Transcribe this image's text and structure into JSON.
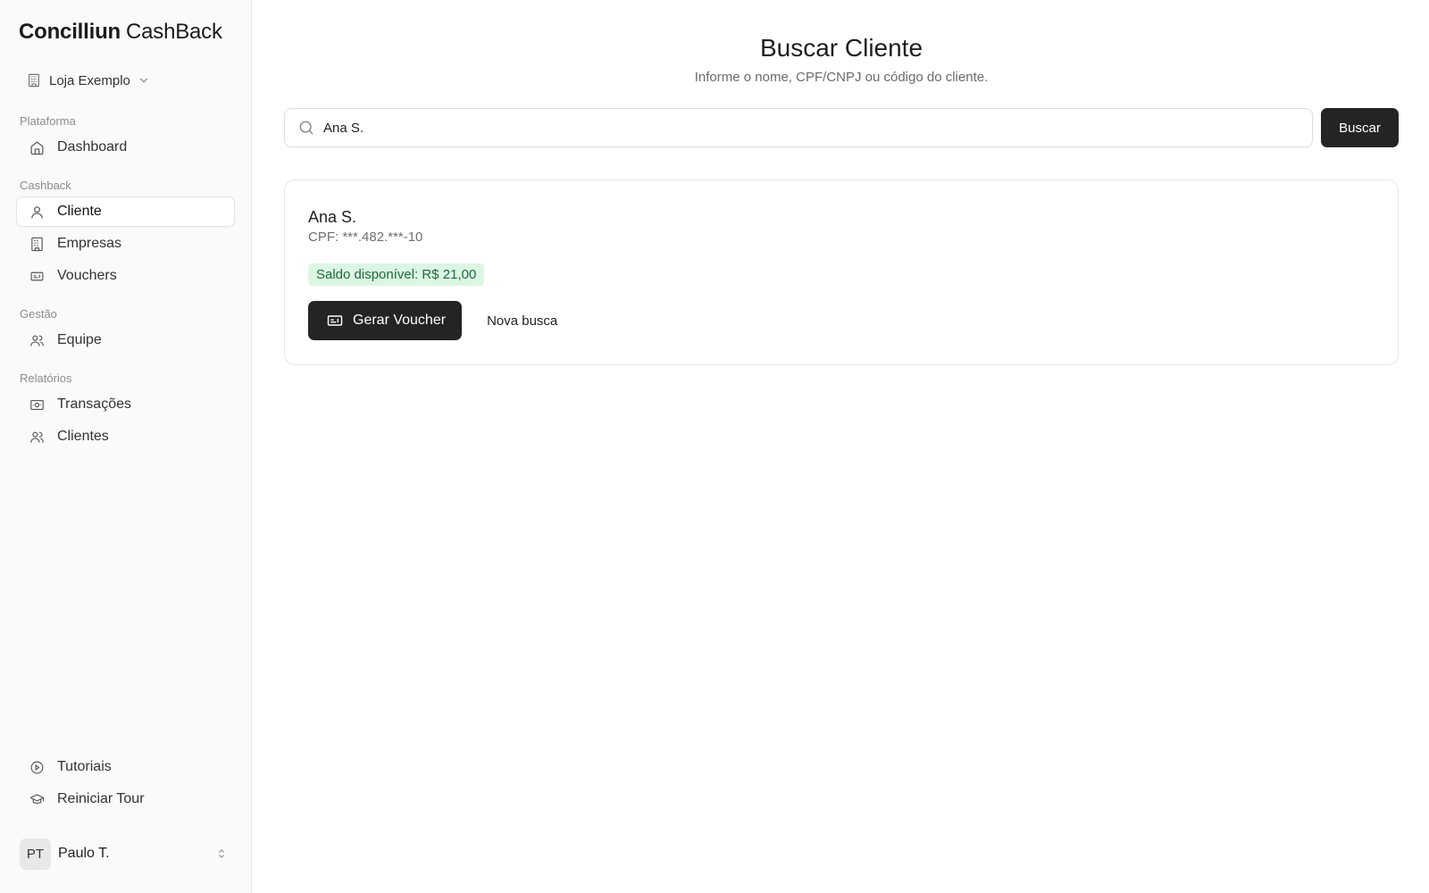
{
  "brand": {
    "bold": "Concilliun",
    "light": "CashBack"
  },
  "store": {
    "name": "Loja Exemplo",
    "icon": "building-icon"
  },
  "nav": {
    "groups": [
      {
        "label": "Plataforma",
        "items": [
          {
            "label": "Dashboard",
            "icon": "home-icon"
          }
        ]
      },
      {
        "label": "Cashback",
        "items": [
          {
            "label": "Cliente",
            "icon": "user-icon",
            "active": true
          },
          {
            "label": "Empresas",
            "icon": "building-icon"
          },
          {
            "label": "Vouchers",
            "icon": "ticket-icon"
          }
        ]
      },
      {
        "label": "Gestão",
        "items": [
          {
            "label": "Equipe",
            "icon": "users-icon"
          }
        ]
      },
      {
        "label": "Relatórios",
        "items": [
          {
            "label": "Transações",
            "icon": "banknote-icon"
          },
          {
            "label": "Clientes",
            "icon": "users-icon"
          }
        ]
      }
    ],
    "bottom": [
      {
        "label": "Tutoriais",
        "icon": "play-circle-icon"
      },
      {
        "label": "Reiniciar Tour",
        "icon": "graduation-cap-icon"
      }
    ]
  },
  "user": {
    "initials": "PT",
    "name": "Paulo T."
  },
  "page": {
    "title": "Buscar Cliente",
    "subtitle": "Informe o nome, CPF/CNPJ ou código do cliente."
  },
  "search": {
    "value": "Ana S.",
    "button": "Buscar"
  },
  "result": {
    "name": "Ana S.",
    "doc": "CPF: ***.482.***-10",
    "balance": "Saldo disponível: R$ 21,00",
    "generate_button": "Gerar Voucher",
    "new_search": "Nova busca"
  },
  "colors": {
    "accent_dark": "#242424",
    "badge_bg": "#dcf6e4",
    "badge_text": "#1c6b3a"
  }
}
